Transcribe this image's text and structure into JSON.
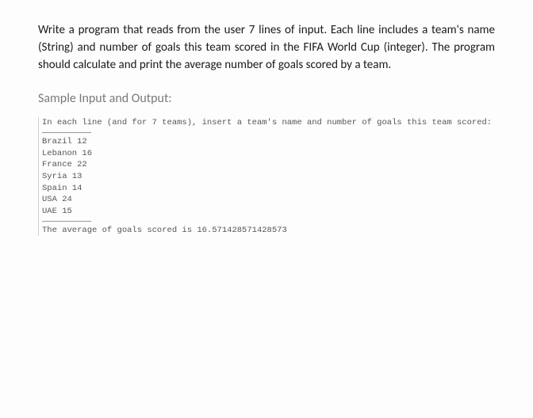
{
  "problem": {
    "statement": "Write a program that reads from the user 7 lines of input. Each line includes a team's name (String) and number of goals this team scored in the FIFA World Cup (integer). The program should calculate and print the average number of goals scored by a team."
  },
  "section": {
    "heading": "Sample Input and Output:"
  },
  "sample": {
    "prompt": "In each line (and for 7 teams), insert a team's name and number of goals this team scored:",
    "lines": [
      "Brazil 12",
      "Lebanon 16",
      "France 22",
      "Syria 13",
      "Spain 14",
      "USA 24",
      "UAE 15"
    ],
    "result": "The average of goals scored is 16.571428571428573"
  }
}
